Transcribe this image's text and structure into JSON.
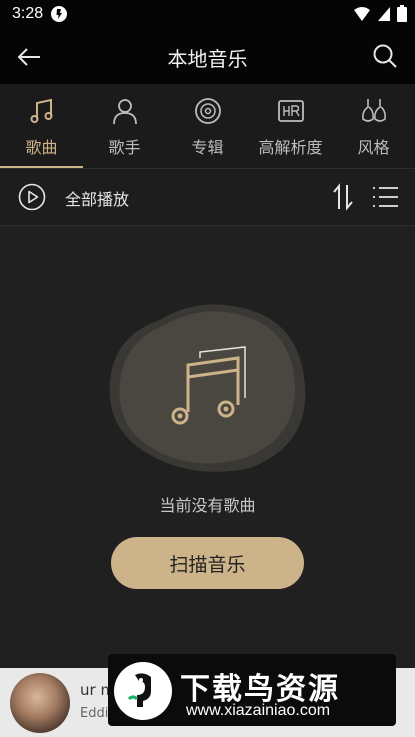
{
  "status": {
    "time": "3:28"
  },
  "header": {
    "title": "本地音乐"
  },
  "tabs": [
    {
      "label": "歌曲",
      "icon": "music-note-icon",
      "active": true
    },
    {
      "label": "歌手",
      "icon": "person-icon",
      "active": false
    },
    {
      "label": "专辑",
      "icon": "disc-icon",
      "active": false
    },
    {
      "label": "高解析度",
      "icon": "hr-icon",
      "active": false
    },
    {
      "label": "风格",
      "icon": "style-icon",
      "active": false
    }
  ],
  "play_row": {
    "label": "全部播放"
  },
  "empty_state": {
    "message": "当前没有歌曲",
    "button_label": "扫描音乐"
  },
  "player": {
    "title": "ur m",
    "artist": "Eddi"
  },
  "watermark": {
    "title": "下载鸟资源",
    "url": "www.xiazainiao.com"
  },
  "colors": {
    "accent": "#cdb389",
    "background": "#202020",
    "header": "#050505"
  }
}
